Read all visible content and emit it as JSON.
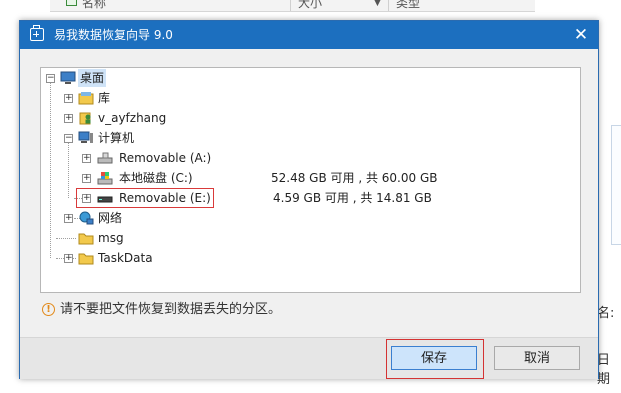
{
  "background": {
    "header_col_name": "名称",
    "header_col_size": "大小",
    "header_col_type": "类型",
    "right_text_1": "名:",
    "right_text_2": "日期"
  },
  "dialog": {
    "title": "易我数据恢复向导 9.0",
    "close_glyph": "✕",
    "tree": [
      {
        "label": "桌面",
        "icon": "desktop-icon"
      },
      {
        "label": "库",
        "icon": "library-icon"
      },
      {
        "label": "v_ayfzhang",
        "icon": "user-folder-icon"
      },
      {
        "label": "计算机",
        "icon": "computer-icon"
      },
      {
        "label": "Removable (A:)",
        "icon": "removable-drive-icon"
      },
      {
        "label": "本地磁盘 (C:)",
        "icon": "local-disk-icon",
        "info": "52.48 GB 可用 , 共 60.00 GB"
      },
      {
        "label": "Removable (E:)",
        "icon": "removable-drive-icon",
        "info": "4.59 GB 可用 , 共 14.81 GB"
      },
      {
        "label": "网络",
        "icon": "network-icon"
      },
      {
        "label": "msg",
        "icon": "folder-icon"
      },
      {
        "label": "TaskData",
        "icon": "folder-icon"
      }
    ],
    "warning": "请不要把文件恢复到数据丢失的分区。",
    "save_label": "保存",
    "cancel_label": "取消"
  },
  "colors": {
    "title_bar": "#1c6fbf",
    "highlight_border": "#d93a3a",
    "selection": "#cfe3f7",
    "primary_button": "#cde4fb",
    "warning_icon": "#e28a1b"
  }
}
